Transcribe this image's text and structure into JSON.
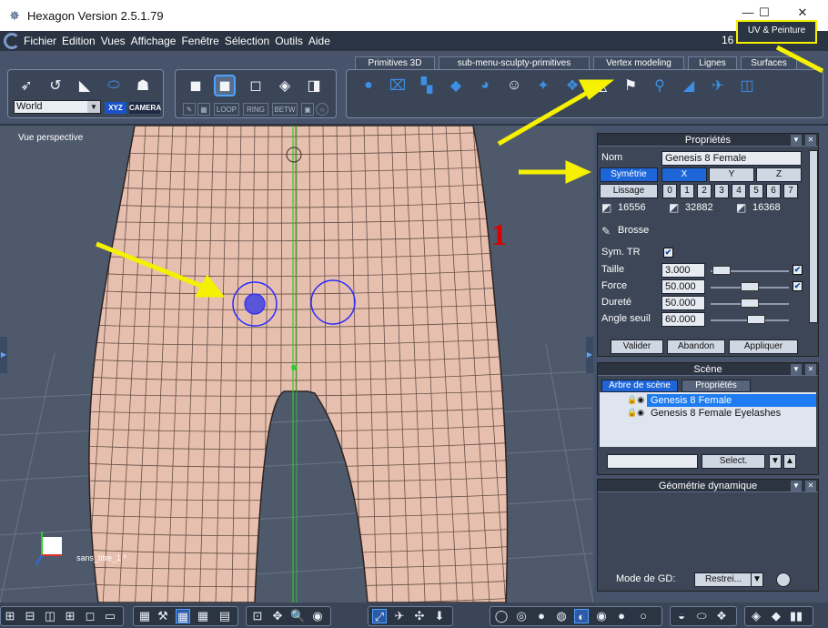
{
  "window": {
    "title": "Hexagon Version 2.5.1.79",
    "min": "—",
    "max": "☐",
    "close": "✕"
  },
  "menubar": {
    "items": [
      "Fichier",
      "Edition",
      "Vues",
      "Affichage",
      "Fenêtre",
      "Sélection",
      "Outils",
      "Aide"
    ],
    "right_number": "16"
  },
  "callout": {
    "uv_peinture": "UV & Peinture"
  },
  "toolbar": {
    "world_select": "World",
    "xyz": "XYZ",
    "camera": "CAMERA",
    "sel_modes": [
      "LOOP",
      "RING",
      "BETW"
    ],
    "tabs": [
      "Primitives 3D",
      "sub-menu-sculpty-primitives",
      "Vertex modeling",
      "Lignes",
      "Surfaces"
    ]
  },
  "viewport": {
    "label": "Vue perspective",
    "scene_name": "sans_titre_1 *",
    "annotation_number": "1"
  },
  "properties": {
    "title": "Propriétés",
    "nom_label": "Nom",
    "nom_value": "Genesis 8 Female",
    "symetrie_label": "Symétrie",
    "axes": [
      "X",
      "Y",
      "Z"
    ],
    "lissage_label": "Lissage",
    "lissage_levels": [
      "0",
      "1",
      "2",
      "3",
      "4",
      "5",
      "6",
      "7"
    ],
    "counts": [
      "16556",
      "32882",
      "16368"
    ],
    "brush_label": "Brosse",
    "sym_tr_label": "Sym. TR",
    "sym_tr_checked": true,
    "taille_label": "Taille",
    "taille_value": "3.000",
    "taille_level": 0.03,
    "force_label": "Force",
    "force_value": "50.000",
    "force_level": 0.5,
    "durete_label": "Dureté",
    "durete_value": "50.000",
    "durete_level": 0.5,
    "angle_label": "Angle seuil",
    "angle_value": "60.000",
    "angle_level": 0.6,
    "valider": "Valider",
    "abandon": "Abandon",
    "appliquer": "Appliquer"
  },
  "scene": {
    "title": "Scène",
    "tab_tree": "Arbre de scène",
    "tab_props": "Propriétés",
    "items": [
      "Genesis 8 Female",
      "Genesis 8 Female Eyelashes"
    ],
    "select_button": "Select.",
    "select_input": ""
  },
  "geometry": {
    "title": "Géométrie dynamique",
    "mode_label": "Mode de GD:",
    "mode_value": "Restrei..."
  },
  "colors": {
    "accent": "#1e66d8",
    "annotation_arrow": "#f6f100",
    "annotation_number": "#d80000",
    "skin": "#e7bfae",
    "wire": "#3a2a26",
    "brush_circle": "#2a2aff"
  }
}
